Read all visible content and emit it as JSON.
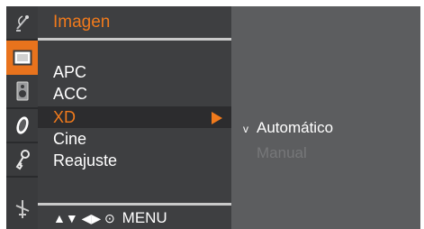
{
  "menu": {
    "title": "Imagen",
    "items": [
      {
        "label": "APC"
      },
      {
        "label": "ACC"
      },
      {
        "label": "XD",
        "selected": true
      },
      {
        "label": "Cine"
      },
      {
        "label": "Reajuste"
      }
    ]
  },
  "submenu": {
    "check_mark": "v",
    "options": [
      {
        "label": "Automático",
        "checked": true
      },
      {
        "label": "Manual",
        "disabled": true
      }
    ]
  },
  "nav_hint": {
    "arrows": "▲▼ ◀▶ ⊙",
    "menu_label": "MENU"
  },
  "icons": [
    "satellite-icon",
    "picture-icon",
    "speaker-icon",
    "clock-icon",
    "key-icon",
    "antenna-icon"
  ],
  "colors": {
    "accent": "#f07a1c",
    "panel": "#3e3f41",
    "background": "#5c5d5f",
    "disabled_text": "#767779"
  }
}
